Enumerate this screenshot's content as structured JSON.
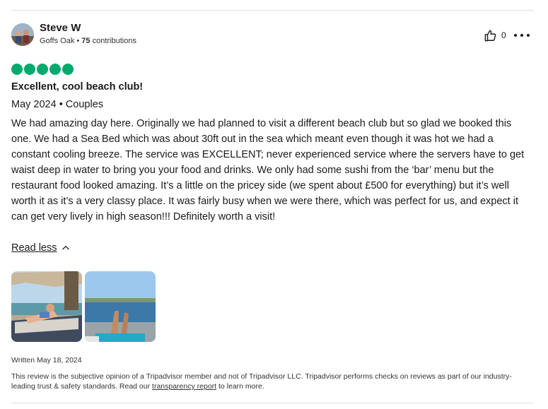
{
  "author": {
    "name": "Steve W",
    "location": "Goffs Oak",
    "separator": " • ",
    "contributions_count": "75",
    "contributions_label": " contributions"
  },
  "actions": {
    "helpful_count": "0",
    "helpful_icon": "thumbs-up-icon",
    "more_icon": "ellipsis-icon"
  },
  "rating": {
    "value": 5,
    "max": 5,
    "color": "#00aa6c"
  },
  "review": {
    "title": "Excellent, cool beach club!",
    "date_and_type": "May 2024 • Couples",
    "text": "We had amazing day here. Originally we had planned to visit a different beach club but so glad we booked this one. We had a Sea Bed which was about 30ft out in the sea which meant even though it was hot we had a constant cooling breeze. The service was EXCELLENT; never experienced service where the servers have to get waist deep in water to bring you your food and drinks. We only had some sushi from the ‘bar’ menu but the restaurant food looked amazing. It’s a little on the pricey side (we spent about £500 for everything) but it’s well worth it as it’s a very classy place. It was fairly busy when we were there, which was perfect for us, and expect it can get very lively in high season!!! Definitely worth a visit!",
    "read_less_label": "Read less"
  },
  "photos": [
    {
      "name": "review-photo-1",
      "description": "woman lying on beach lounger under umbrella"
    },
    {
      "name": "review-photo-2",
      "description": "legs on sea bed overlooking water"
    }
  ],
  "footer": {
    "written_date": "Written May 18, 2024",
    "disclaimer_before": "This review is the subjective opinion of a Tripadvisor member and not of Tripadvisor LLC. Tripadvisor performs checks on reviews as part of our industry-leading trust & safety standards. Read our ",
    "disclaimer_link": "transparency report",
    "disclaimer_after": " to learn more."
  }
}
